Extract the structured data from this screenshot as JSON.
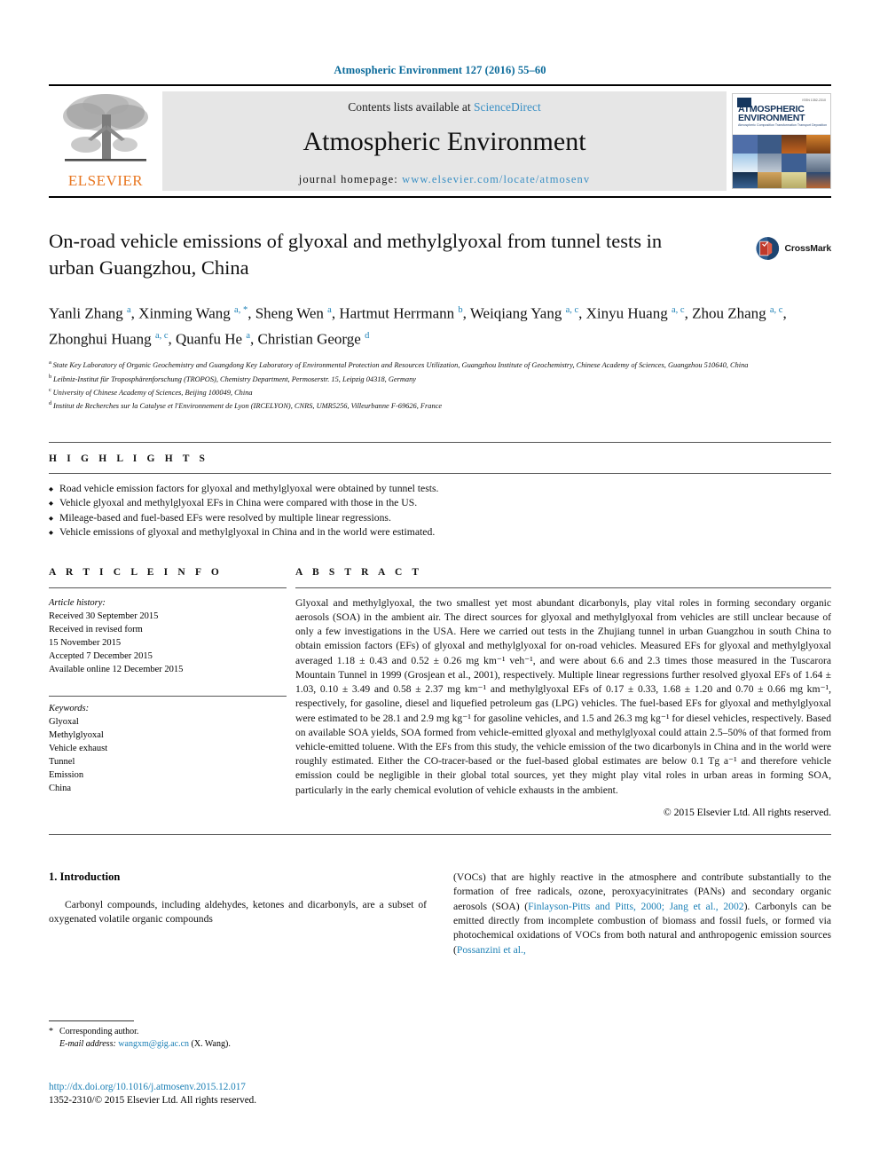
{
  "running_head": "Atmospheric Environment 127 (2016) 55–60",
  "masthead": {
    "publisher_name": "ELSEVIER",
    "contents_prefix": "Contents lists available at ",
    "contents_link": "ScienceDirect",
    "journal_title": "Atmospheric Environment",
    "homepage_label": "journal homepage: ",
    "homepage_url": "www.elsevier.com/locate/atmosenv",
    "cover": {
      "title_line1": "ATMOSPHERIC",
      "title_line2": "ENVIRONMENT",
      "subtitle": "Atmospheric Composition Transformation Transport Deposition",
      "issn": "ISSN 1352-2310"
    }
  },
  "article": {
    "title": "On-road vehicle emissions of glyoxal and methylglyoxal from tunnel tests in urban Guangzhou, China",
    "crossmark_label": "CrossMark",
    "authors": [
      {
        "name": "Yanli Zhang",
        "sup": "a",
        "sep": ", "
      },
      {
        "name": "Xinming Wang",
        "sup": "a, *",
        "sep": ", "
      },
      {
        "name": "Sheng Wen",
        "sup": "a",
        "sep": ", "
      },
      {
        "name": "Hartmut Herrmann",
        "sup": "b",
        "sep": ", "
      },
      {
        "name": "Weiqiang Yang",
        "sup": "a, c",
        "sep": ", "
      },
      {
        "name": "Xinyu Huang",
        "sup": "a, c",
        "sep": ", "
      },
      {
        "name": "Zhou Zhang",
        "sup": "a, c",
        "sep": ", "
      },
      {
        "name": "Zhonghui Huang",
        "sup": "a, c",
        "sep": ", "
      },
      {
        "name": "Quanfu He",
        "sup": "a",
        "sep": ", "
      },
      {
        "name": "Christian George",
        "sup": "d",
        "sep": ""
      }
    ],
    "affiliations": [
      {
        "marker": "a",
        "text": "State Key Laboratory of Organic Geochemistry and Guangdong Key Laboratory of Environmental Protection and Resources Utilization, Guangzhou Institute of Geochemistry, Chinese Academy of Sciences, Guangzhou 510640, China"
      },
      {
        "marker": "b",
        "text": "Leibniz-Institut für Troposphärenforschung (TROPOS), Chemistry Department, Permoserstr. 15, Leipzig 04318, Germany"
      },
      {
        "marker": "c",
        "text": "University of Chinese Academy of Sciences, Beijing 100049, China"
      },
      {
        "marker": "d",
        "text": "Institut de Recherches sur la Catalyse et l'Environnement de Lyon (IRCELYON), CNRS, UMR5256, Villeurbanne F-69626, France"
      }
    ]
  },
  "highlights": {
    "heading": "H I G H L I G H T S",
    "items": [
      "Road vehicle emission factors for glyoxal and methylglyoxal were obtained by tunnel tests.",
      "Vehicle glyoxal and methylglyoxal EFs in China were compared with those in the US.",
      "Mileage-based and fuel-based EFs were resolved by multiple linear regressions.",
      "Vehicle emissions of glyoxal and methylglyoxal in China and in the world were estimated."
    ]
  },
  "article_info": {
    "heading": "A R T I C L E   I N F O",
    "history_label": "Article history:",
    "history": [
      "Received 30 September 2015",
      "Received in revised form",
      "15 November 2015",
      "Accepted 7 December 2015",
      "Available online 12 December 2015"
    ],
    "keywords_label": "Keywords:",
    "keywords": [
      "Glyoxal",
      "Methylglyoxal",
      "Vehicle exhaust",
      "Tunnel",
      "Emission",
      "China"
    ]
  },
  "abstract": {
    "heading": "A B S T R A C T",
    "text": "Glyoxal and methylglyoxal, the two smallest yet most abundant dicarbonyls, play vital roles in forming secondary organic aerosols (SOA) in the ambient air. The direct sources for glyoxal and methylglyoxal from vehicles are still unclear because of only a few investigations in the USA. Here we carried out tests in the Zhujiang tunnel in urban Guangzhou in south China to obtain emission factors (EFs) of glyoxal and methylglyoxal for on-road vehicles. Measured EFs for glyoxal and methylglyoxal averaged 1.18 ± 0.43 and 0.52 ± 0.26 mg km⁻¹ veh⁻¹, and were about 6.6 and 2.3 times those measured in the Tuscarora Mountain Tunnel in 1999 (Grosjean et al., 2001), respectively. Multiple linear regressions further resolved glyoxal EFs of 1.64 ± 1.03, 0.10 ± 3.49 and 0.58 ± 2.37 mg km⁻¹ and methylglyoxal EFs of 0.17 ± 0.33, 1.68 ± 1.20 and 0.70 ± 0.66 mg km⁻¹, respectively, for gasoline, diesel and liquefied petroleum gas (LPG) vehicles. The fuel-based EFs for glyoxal and methylglyoxal were estimated to be 28.1 and 2.9 mg kg⁻¹ for gasoline vehicles, and 1.5 and 26.3 mg kg⁻¹ for diesel vehicles, respectively. Based on available SOA yields, SOA formed from vehicle-emitted glyoxal and methylglyoxal could attain 2.5–50% of that formed from vehicle-emitted toluene. With the EFs from this study, the vehicle emission of the two dicarbonyls in China and in the world were roughly estimated. Either the CO-tracer-based or the fuel-based global estimates are below 0.1 Tg a⁻¹ and therefore vehicle emission could be negligible in their global total sources, yet they might play vital roles in urban areas in forming SOA, particularly in the early chemical evolution of vehicle exhausts in the ambient.",
    "copyright": "© 2015 Elsevier Ltd. All rights reserved."
  },
  "body": {
    "section_title": "1. Introduction",
    "left_paragraph": "Carbonyl compounds, including aldehydes, ketones and dicarbonyls, are a subset of oxygenated volatile organic compounds",
    "right_paragraph_part1": "(VOCs) that are highly reactive in the atmosphere and contribute substantially to the formation of free radicals, ozone, peroxyacyinitrates (PANs) and secondary organic aerosols (SOA) (",
    "right_citation1": "Finlayson-Pitts and Pitts, 2000; Jang et al., 2002",
    "right_paragraph_part2": "). Carbonyls can be emitted directly from incomplete combustion of biomass and fossil fuels, or formed via photochemical oxidations of VOCs from both natural and anthropogenic emission sources (",
    "right_citation2": "Possanzini et al.,"
  },
  "footnote": {
    "star": "*",
    "corresponding": "Corresponding author.",
    "email_label": "E-mail address: ",
    "email": "wangxm@gig.ac.cn",
    "email_suffix": " (X. Wang)."
  },
  "footer": {
    "doi": "http://dx.doi.org/10.1016/j.atmosenv.2015.12.017",
    "issn_line": "1352-2310/© 2015 Elsevier Ltd. All rights reserved."
  },
  "colors": {
    "link_blue": "#1a7fb5",
    "sciencedirect_blue": "#3a8fc4",
    "elsevier_orange": "#e87722",
    "banner_gray": "#e6e6e6"
  }
}
